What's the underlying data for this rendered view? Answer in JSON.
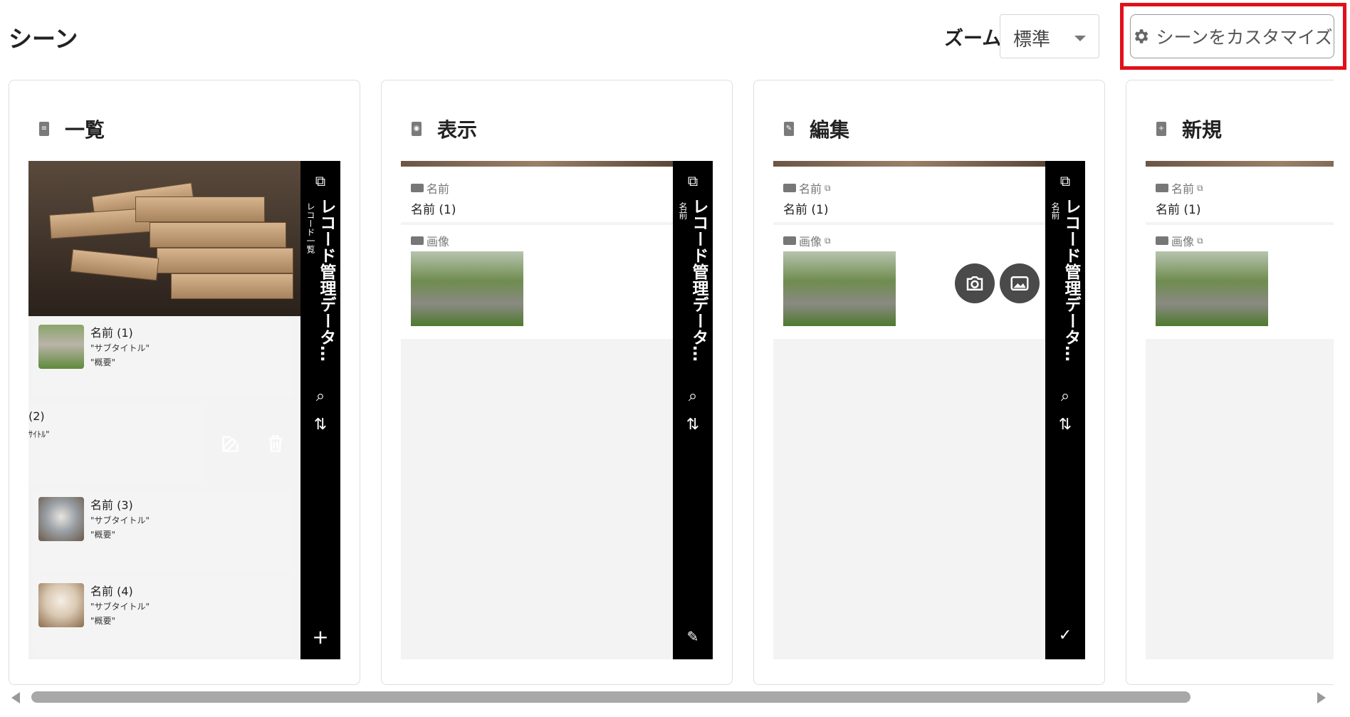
{
  "header": {
    "title": "シーン",
    "zoom_label": "ズーム",
    "zoom_value": "標準",
    "customize_button": "シーンをカスタマイズ"
  },
  "scenes": [
    {
      "title": "一覧",
      "app_title": "レコード管理データ…",
      "app_subtitle": "レコード一覧",
      "items": [
        {
          "name": "名前 (1)",
          "subtitle": "\"サブタイトル\"",
          "summary": "\"概要\""
        },
        {
          "name": "(2)",
          "subtitle": "ｻｲﾄﾙ\"",
          "summary": ""
        },
        {
          "name": "名前 (3)",
          "subtitle": "\"サブタイトル\"",
          "summary": "\"概要\""
        },
        {
          "name": "名前 (4)",
          "subtitle": "\"サブタイトル\"",
          "summary": "\"概要\""
        }
      ]
    },
    {
      "title": "表示",
      "app_title": "レコード管理データ…",
      "app_subtitle": "名前",
      "fields": [
        {
          "label": "名前",
          "value": "名前 (1)"
        },
        {
          "label": "画像"
        }
      ]
    },
    {
      "title": "編集",
      "app_title": "レコード管理データ…",
      "app_subtitle": "名前",
      "fields": [
        {
          "label": "名前",
          "value": "名前 (1)"
        },
        {
          "label": "画像"
        }
      ]
    },
    {
      "title": "新規",
      "fields": [
        {
          "label": "名前",
          "value": "名前 (1)"
        },
        {
          "label": "画像"
        }
      ]
    }
  ],
  "colors": {
    "highlight": "#e0101b",
    "sidebar": "#000000",
    "card_border": "#dedede"
  },
  "icons": [
    "gear-icon",
    "copy-icon",
    "search-icon",
    "sort-icon",
    "add-icon",
    "edit-icon",
    "delete-icon",
    "check-icon",
    "camera-icon",
    "image-icon"
  ]
}
